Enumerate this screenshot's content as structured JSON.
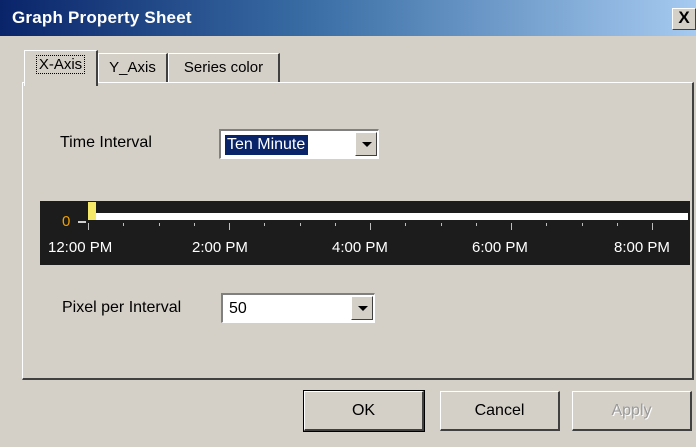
{
  "window": {
    "title": "Graph Property Sheet",
    "close_label": "X"
  },
  "tabs": [
    {
      "label": "X-Axis",
      "active": true
    },
    {
      "label": "Y_Axis",
      "active": false
    },
    {
      "label": "Series color",
      "active": false
    }
  ],
  "time_interval": {
    "label": "Time Interval",
    "value": "Ten Minute"
  },
  "axis_preview": {
    "zero_label": "0",
    "tick_labels": [
      "12:00 PM",
      "2:00 PM",
      "4:00 PM",
      "6:00 PM",
      "8:00 PM"
    ],
    "axis_color": "#ffffff",
    "marker_color": "#f6e96a",
    "background_color": "#1c1c1c"
  },
  "pixel_per_interval": {
    "label": "Pixel per Interval",
    "value": "50"
  },
  "buttons": {
    "ok": "OK",
    "cancel": "Cancel",
    "apply": "Apply"
  },
  "colors": {
    "title_bar_start": "#0a246a",
    "title_bar_end": "#a6caf0",
    "dialog_face": "#d4d0c8"
  }
}
